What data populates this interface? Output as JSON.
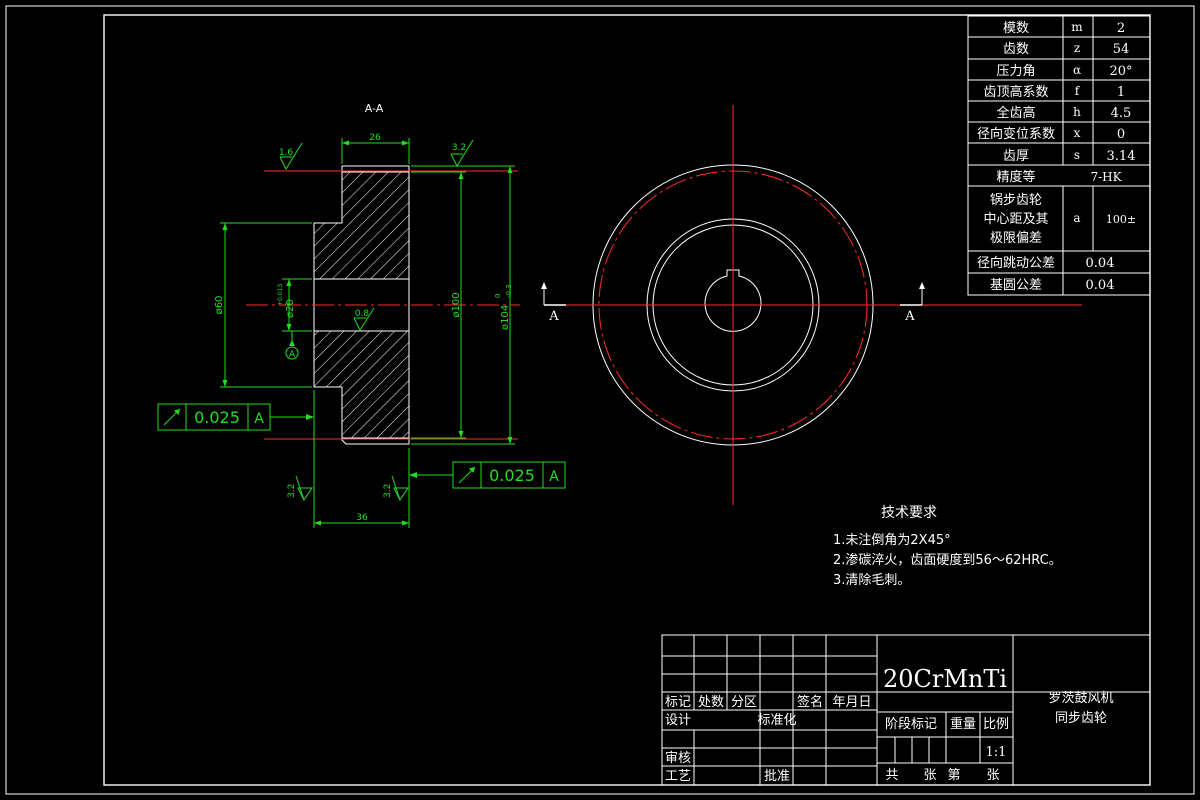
{
  "section_label": "A-A",
  "cut_marker": "A",
  "datum_label": "A",
  "dims": {
    "hub_width": "26",
    "total_width": "36",
    "hub_diameter": "ø60",
    "bore": "ø20",
    "bore_tol": "+0.013",
    "bore_tol_low": "0",
    "root_diameter": "ø100",
    "outer_diameter": "ø104",
    "outer_tol_up": "0",
    "outer_tol_low": "-0.3"
  },
  "roughness": {
    "top_left": "1.6",
    "top_right": "3.2",
    "bore": "0.8",
    "bottom_left": "3.2",
    "bottom_right": "3.2"
  },
  "runout_frames": [
    {
      "value": "0.025",
      "datum": "A"
    },
    {
      "value": "0.025",
      "datum": "A"
    }
  ],
  "params": [
    {
      "name": "模数",
      "sym": "m",
      "val": "2"
    },
    {
      "name": "齿数",
      "sym": "z",
      "val": "54"
    },
    {
      "name": "压力角",
      "sym": "α",
      "val": "20°"
    },
    {
      "name": "齿顶高系数",
      "sym": "f",
      "val": "1"
    },
    {
      "name": "全齿高",
      "sym": "h",
      "val": "4.5"
    },
    {
      "name": "径向变位系数",
      "sym": "x",
      "val": "0"
    },
    {
      "name": "齿厚",
      "sym": "s",
      "val": "3.14"
    }
  ],
  "precision": {
    "name": "精度等",
    "val": "7-HK"
  },
  "center": {
    "lines": [
      "锅步齿轮",
      "中心距及其",
      "极限偏差"
    ],
    "sym": "a",
    "val": "100±"
  },
  "runout_tol": {
    "name": "径向跳动公差",
    "val": "0.04"
  },
  "base_tol": {
    "name": "基圆公差",
    "val": "0.04"
  },
  "tech": {
    "title": "技术要求",
    "items": [
      "1.未注倒角为2X45°",
      "2.渗碳淬火，齿面硬度到56～62HRC。",
      "3.清除毛刺。"
    ]
  },
  "title_block": {
    "material": "20CrMnTi",
    "name1": "罗茨鼓风机",
    "name2": "同步齿轮",
    "rev_headers": [
      "标记",
      "处数",
      "分区",
      "",
      "签名",
      "年月日"
    ],
    "design": "设计",
    "standardize": "标准化",
    "review": "审核",
    "process": "工艺",
    "approve": "批准",
    "stage_mark": "阶段标记",
    "weight": "重量",
    "scale_label": "比例",
    "scale": "1:1",
    "sheet_total": "共",
    "sheet_unit1": "张",
    "sheet_no": "第",
    "sheet_unit2": "张"
  }
}
